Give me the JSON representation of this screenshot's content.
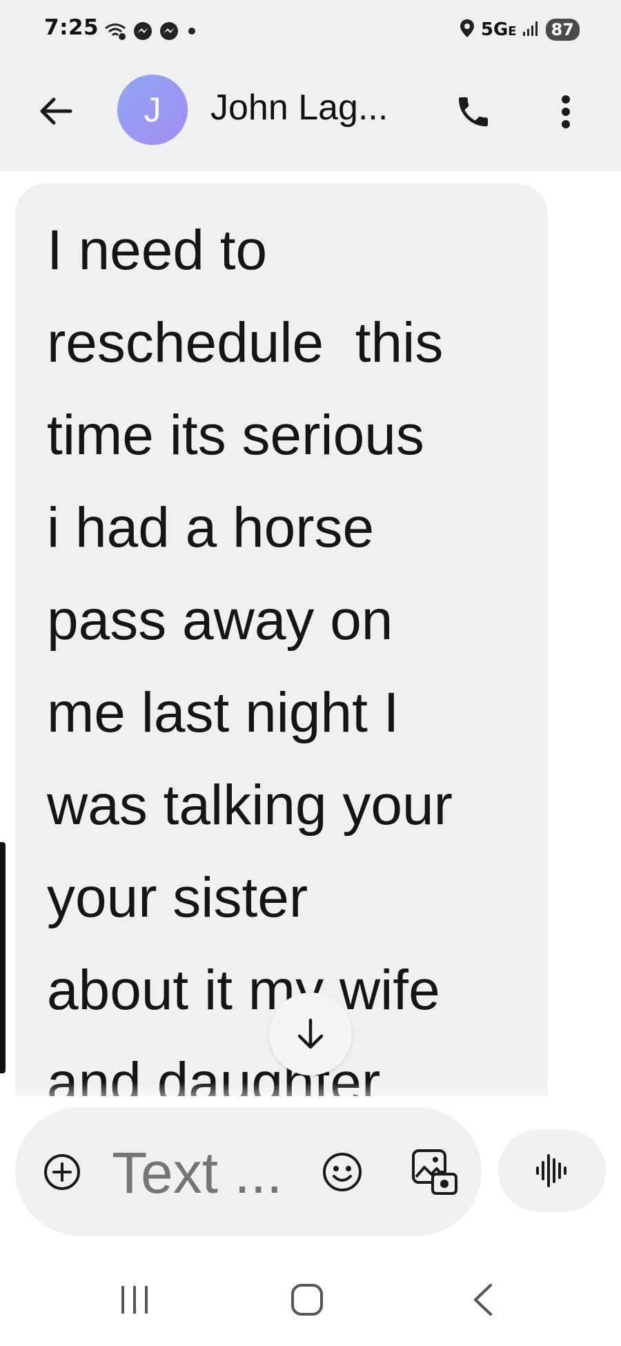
{
  "status_bar": {
    "time": "7:25",
    "network": "5G",
    "network_suffix": "E",
    "battery": "87",
    "left_icons": [
      "wifi-call-icon",
      "messenger-icon",
      "messenger-icon",
      "dot-icon"
    ],
    "right_icons": [
      "location-icon",
      "signal-icon"
    ]
  },
  "header": {
    "avatar_letter": "J",
    "contact_name": "John Lag...",
    "icons": {
      "back": "arrow-left-icon",
      "call": "phone-icon",
      "more": "more-vert-icon"
    }
  },
  "conversation": {
    "message": "I need to\nreschedule  this\ntime its serious\ni had a horse\npass away on\nme last night I\nwas talking your\nyour sister\nabout it my wife\nand daughter",
    "scroll_icon": "arrow-down-icon"
  },
  "compose": {
    "placeholder": "Text ...",
    "icons": {
      "attach": "add-circle-icon",
      "emoji": "emoji-icon",
      "gallery": "gallery-icon",
      "voice": "voice-waveform-icon"
    }
  },
  "navigation": {
    "icons": [
      "recents-icon",
      "home-icon",
      "back-icon"
    ]
  },
  "colors": {
    "bar_background": "#eef0f2",
    "bubble_background": "#eef0f2",
    "avatar_start": "#8fa8f4",
    "avatar_end": "#a28cf0"
  }
}
